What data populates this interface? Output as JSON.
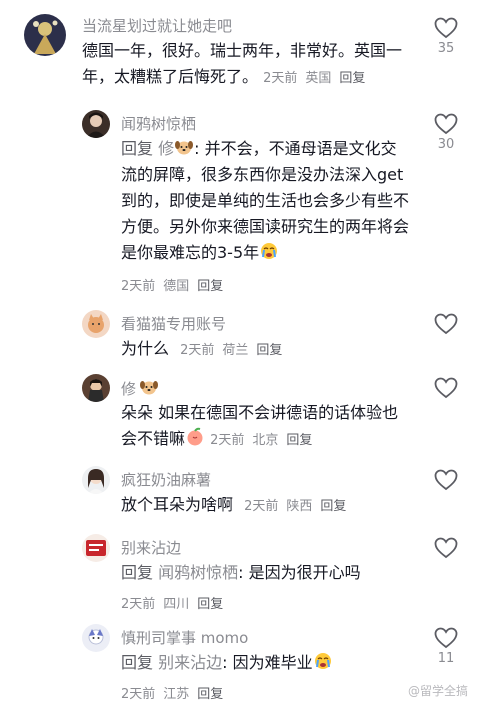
{
  "comments": [
    {
      "username": "当流星划过就让她走吧",
      "text": "德国一年，很好。瑞士两年，非常好。英国一年，太糟糕了后悔死了。",
      "time": "2天前",
      "location": "英国",
      "reply_label": "回复",
      "likes": "35"
    },
    {
      "username": "闻鸦树惊栖",
      "reply_prefix": "回复",
      "reply_to": "修",
      "text_a": ": 并不会，不通母语是文化交流的屏障，很多东西你是没办法深入get到的，即使是单纯的生活也会多少有些不方便。另外你来德国读研究生的两年将会是你最难忘的3-5年",
      "time": "2天前",
      "location": "德国",
      "reply_label": "回复",
      "likes": "30"
    },
    {
      "username": "看猫猫专用账号",
      "text": "为什么",
      "time": "2天前",
      "location": "荷兰",
      "reply_label": "回复"
    },
    {
      "username": "修",
      "text": "朵朵 如果在德国不会讲德语的话体验也会不错嘛",
      "time": "2天前",
      "location": "北京",
      "reply_label": "回复"
    },
    {
      "username": "疯狂奶油麻薯",
      "text": "放个耳朵为啥啊",
      "time": "2天前",
      "location": "陕西",
      "reply_label": "回复"
    },
    {
      "username": "别来沾边",
      "reply_prefix": "回复",
      "reply_to": "闻鸦树惊栖",
      "text": ": 是因为很开心吗",
      "time": "2天前",
      "location": "四川",
      "reply_label": "回复"
    },
    {
      "username": "慎刑司掌事 momo",
      "reply_prefix": "回复",
      "reply_to": "别来沾边",
      "text": ": 因为难毕业",
      "time": "2天前",
      "location": "江苏",
      "reply_label": "回复",
      "likes": "11"
    }
  ],
  "watermark": "@留学全搞",
  "colors": {
    "text": "#161823",
    "muted": "#8a8b91",
    "background": "#ffffff"
  }
}
